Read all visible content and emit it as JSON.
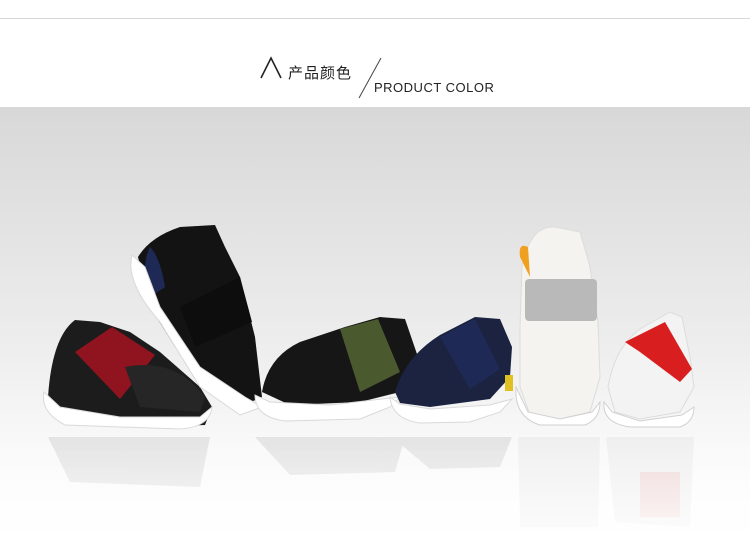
{
  "header": {
    "title_cn": "产品颜色",
    "title_en": "PRODUCT COLOR"
  },
  "photo": {
    "description_icon": "shoes-photo-icon",
    "shoes": [
      {
        "strap_color": "#8f1420",
        "body_color": "#1b1b1b"
      },
      {
        "strap_color": "#111111",
        "body_color": "#111111"
      },
      {
        "strap_color": "#4b5a2e",
        "body_color": "#151515"
      },
      {
        "strap_color": "#1e2a55",
        "body_color": "#1b2340"
      },
      {
        "strap_color": "#b9b9b9",
        "body_color": "#f4f3ef"
      },
      {
        "strap_color": "#d81e1e",
        "body_color": "#f3f3f3"
      }
    ]
  }
}
